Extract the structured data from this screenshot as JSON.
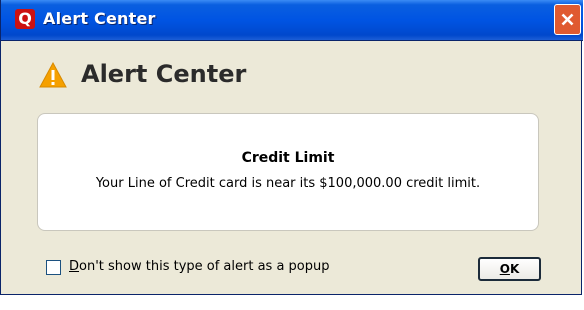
{
  "window": {
    "title": "Alert Center",
    "app_icon_letter": "Q"
  },
  "header": {
    "title": "Alert Center",
    "icon": "warning-icon"
  },
  "alert": {
    "title": "Credit Limit",
    "message": "Your Line of Credit card is near its $100,000.00 credit limit."
  },
  "footer": {
    "checkbox_label_hotkey": "D",
    "checkbox_label_rest": "on't show this type of alert as a popup",
    "checkbox_checked": false,
    "ok_hotkey": "O",
    "ok_rest": "K"
  },
  "colors": {
    "titlebar": "#0054e3",
    "close_button": "#e05a30",
    "warning": "#f5a000",
    "dialog_background": "#ece9d8"
  }
}
